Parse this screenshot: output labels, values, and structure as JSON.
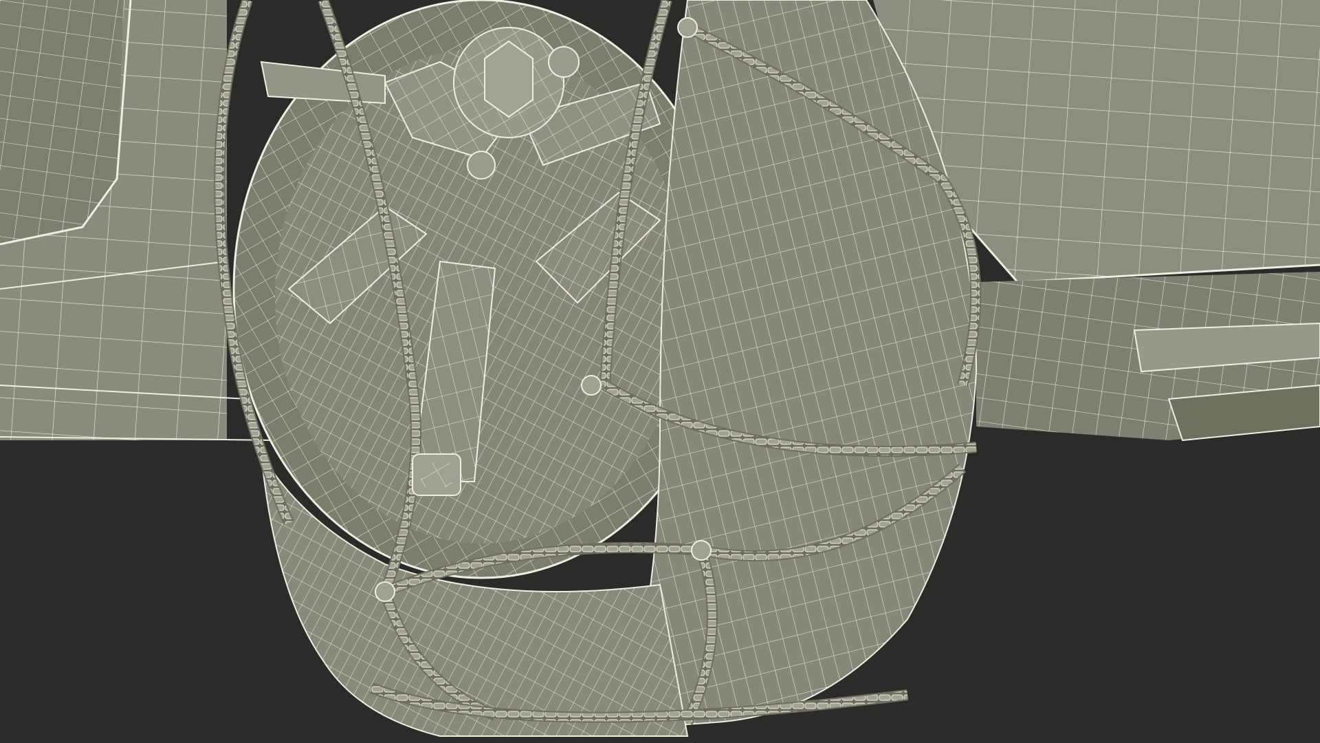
{
  "scene": {
    "subject": "wireframe-render",
    "colors": {
      "background": "#2b2b2a",
      "mesh_fill": "#8a8b7c",
      "mesh_fill_dark": "#6f705f",
      "mesh_fill_light": "#9c9d8d",
      "wire": "#efeee2",
      "chain": "#9a9a8a"
    }
  }
}
